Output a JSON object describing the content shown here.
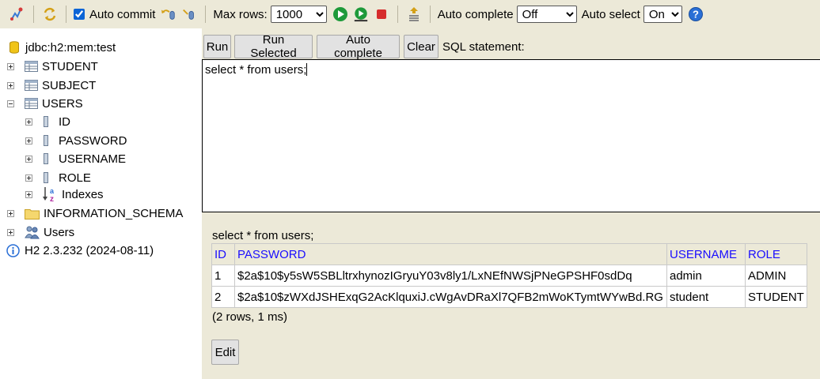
{
  "toolbar": {
    "icons": [
      "disconnect-icon",
      "refresh-icon",
      "rollback-icon",
      "commit-icon",
      "run-icon",
      "run-selected-icon",
      "stop-icon",
      "history-icon",
      "help-icon"
    ],
    "auto_commit_label": "Auto commit",
    "auto_commit_checked": true,
    "max_rows_label": "Max rows:",
    "max_rows_value": "1000",
    "auto_complete_label": "Auto complete",
    "auto_complete_value": "Off",
    "auto_select_label": "Auto select",
    "auto_select_value": "On",
    "colors": {
      "background": "#ece9d8",
      "run_green": "#1e9a3a",
      "stop_red": "#d62c2c",
      "help_blue": "#2a6fd6"
    }
  },
  "tree": {
    "connection": "jdbc:h2:mem:test",
    "tables": [
      "STUDENT",
      "SUBJECT",
      "USERS"
    ],
    "users_columns": [
      "ID",
      "PASSWORD",
      "USERNAME",
      "ROLE"
    ],
    "indexes_label": "Indexes",
    "information_schema": "INFORMATION_SCHEMA",
    "users_node": "Users",
    "version": "H2 2.3.232 (2024-08-11)"
  },
  "query": {
    "buttons": {
      "run": "Run",
      "run_selected": "Run Selected",
      "auto_complete": "Auto complete",
      "clear": "Clear"
    },
    "sql_label": "SQL statement:",
    "sql_text": "select * from users;"
  },
  "result": {
    "sql": "select * from users;",
    "columns": [
      "ID",
      "PASSWORD",
      "USERNAME",
      "ROLE"
    ],
    "rows": [
      [
        "1",
        "$2a$10$y5sW5SBLltrxhynozIGryuY03v8ly1/LxNEfNWSjPNeGPSHF0sdDq",
        "admin",
        "ADMIN"
      ],
      [
        "2",
        "$2a$10$zWXdJSHExqG2AcKlquxiJ.cWgAvDRaXl7QFB2mWoKTymtWYwBd.RG",
        "student",
        "STUDENT"
      ]
    ],
    "footer": "(2 rows, 1 ms)",
    "edit_label": "Edit",
    "header_color": "#1a0dff"
  }
}
